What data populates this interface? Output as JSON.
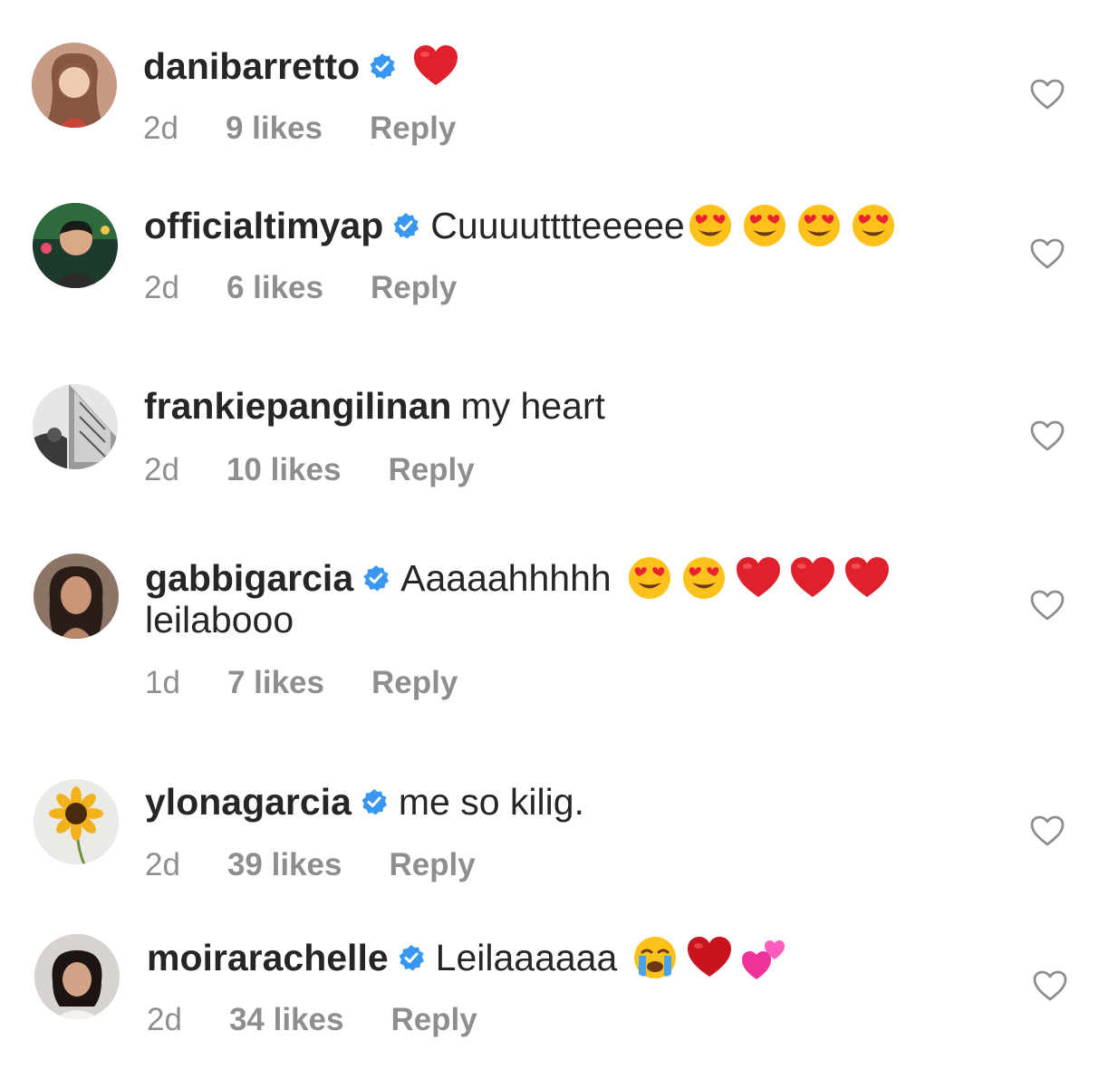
{
  "comments": [
    {
      "username": "danibarretto",
      "verified": true,
      "text": "",
      "emojis": [
        "red-heart"
      ],
      "time": "2d",
      "likes": "9 likes",
      "reply": "Reply"
    },
    {
      "username": "officialtimyap",
      "verified": true,
      "text": "Cuuuutttteeeee",
      "emojis": [
        "heart-eyes",
        "heart-eyes",
        "heart-eyes",
        "heart-eyes"
      ],
      "time": "2d",
      "likes": "6 likes",
      "reply": "Reply"
    },
    {
      "username": "frankiepangilinan",
      "verified": false,
      "text": "my heart",
      "emojis": [],
      "time": "2d",
      "likes": "10 likes",
      "reply": "Reply"
    },
    {
      "username": "gabbigarcia",
      "verified": true,
      "text": "Aaaaahhhhh",
      "emojis": [
        "heart-eyes",
        "heart-eyes",
        "red-heart",
        "red-heart",
        "red-heart"
      ],
      "text2": "leilabooo",
      "time": "1d",
      "likes": "7 likes",
      "reply": "Reply"
    },
    {
      "username": "ylonagarcia",
      "verified": true,
      "text": "me so kilig.",
      "emojis": [],
      "time": "2d",
      "likes": "39 likes",
      "reply": "Reply"
    },
    {
      "username": "moirarachelle",
      "verified": true,
      "text": "Leilaaaaaa",
      "emojis": [
        "crying-face",
        "red-heart",
        "two-hearts"
      ],
      "time": "2d",
      "likes": "34 likes",
      "reply": "Reply"
    }
  ],
  "colors": {
    "verified_blue": "#3897f0",
    "meta_gray": "#8e8e8e",
    "text_dark": "#262626"
  }
}
